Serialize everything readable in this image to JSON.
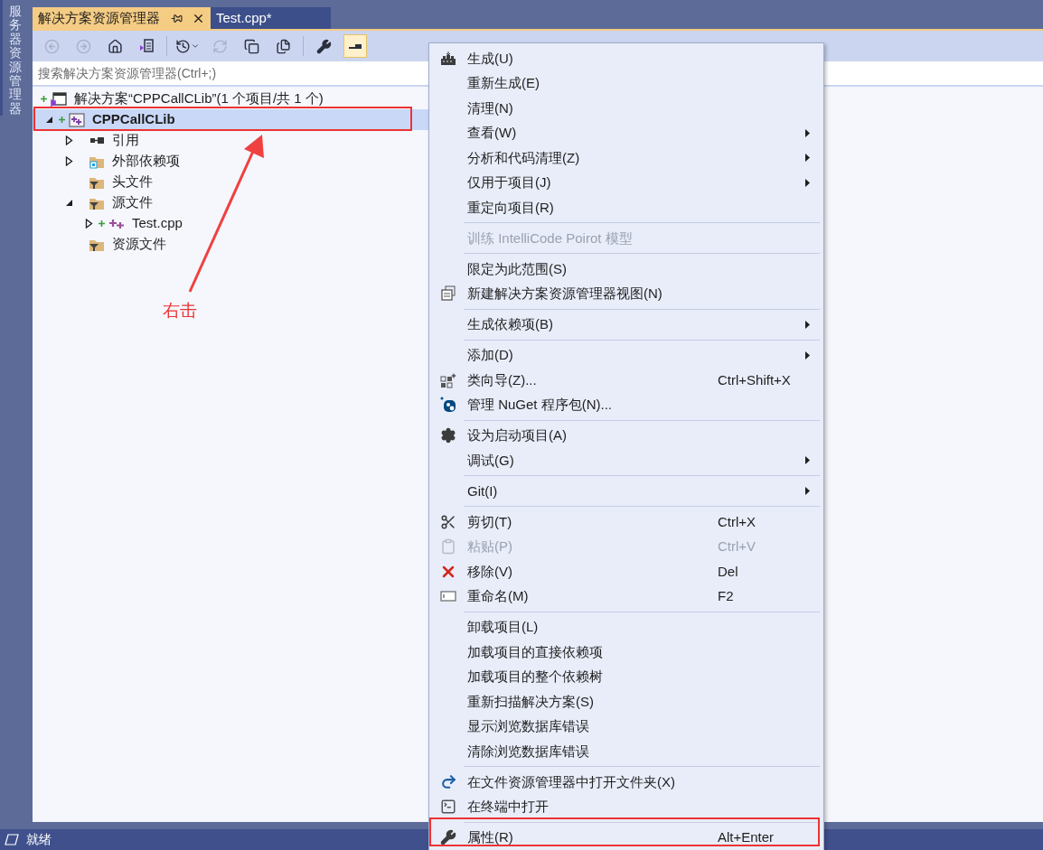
{
  "side_tab": {
    "label": "服务器资源管理器"
  },
  "tabs": [
    {
      "label": "解决方案资源管理器",
      "selected": true
    },
    {
      "label": "Test.cpp*",
      "selected": false
    }
  ],
  "toolbar": [
    {
      "kind": "back",
      "disabled": true,
      "pressed": false
    },
    {
      "kind": "forward",
      "disabled": true,
      "pressed": false
    },
    {
      "kind": "home",
      "disabled": false,
      "pressed": false
    },
    {
      "kind": "switch_views",
      "disabled": false,
      "pressed": false
    },
    {
      "kind": "separator"
    },
    {
      "kind": "pending_changes",
      "disabled": false,
      "pressed": false
    },
    {
      "kind": "refresh",
      "disabled": true,
      "pressed": false
    },
    {
      "kind": "collapse_all",
      "disabled": false,
      "pressed": false
    },
    {
      "kind": "show_all",
      "disabled": false,
      "pressed": false
    },
    {
      "kind": "separator"
    },
    {
      "kind": "properties",
      "disabled": false,
      "pressed": false
    },
    {
      "kind": "preview",
      "disabled": false,
      "pressed": true
    }
  ],
  "search": {
    "placeholder": "搜索解决方案资源管理器(Ctrl+;)"
  },
  "tree": [
    {
      "label": "解决方案“CPPCallCLib”(1 个项目/共 1 个)",
      "kind": "solution",
      "added": true,
      "selected": false,
      "children": [
        {
          "label": "CPPCallCLib",
          "kind": "project",
          "added": true,
          "selected": true,
          "expanded": true,
          "children": [
            {
              "label": "引用",
              "kind": "references",
              "added": false,
              "selected": false,
              "expanded": false
            },
            {
              "label": "外部依赖项",
              "kind": "external",
              "added": false,
              "selected": false,
              "expanded": false
            },
            {
              "label": "头文件",
              "kind": "filter",
              "added": false,
              "selected": false
            },
            {
              "label": "源文件",
              "kind": "filter",
              "added": false,
              "selected": false,
              "expanded": true,
              "children": [
                {
                  "label": "Test.cpp",
                  "kind": "cpp",
                  "added": true,
                  "selected": false,
                  "expanded": false
                }
              ]
            },
            {
              "label": "资源文件",
              "kind": "filter",
              "added": false,
              "selected": false
            }
          ]
        }
      ]
    }
  ],
  "context_menu": [
    {
      "kind": "item",
      "label": "生成(U)",
      "disabled": false,
      "submenu": false
    },
    {
      "kind": "item",
      "label": "重新生成(E)",
      "disabled": false,
      "submenu": false
    },
    {
      "kind": "item",
      "label": "清理(N)",
      "disabled": false,
      "submenu": false
    },
    {
      "kind": "item",
      "label": "查看(W)",
      "disabled": false,
      "submenu": true
    },
    {
      "kind": "item",
      "label": "分析和代码清理(Z)",
      "disabled": false,
      "submenu": true
    },
    {
      "kind": "item",
      "label": "仅用于项目(J)",
      "disabled": false,
      "submenu": true
    },
    {
      "kind": "item",
      "label": "重定向项目(R)",
      "disabled": false,
      "submenu": false
    },
    {
      "kind": "separator"
    },
    {
      "kind": "item",
      "label": "训练 IntelliCode Poirot 模型",
      "disabled": true,
      "submenu": false
    },
    {
      "kind": "separator"
    },
    {
      "kind": "item",
      "label": "限定为此范围(S)",
      "disabled": false,
      "submenu": false
    },
    {
      "kind": "item",
      "label": "新建解决方案资源管理器视图(N)",
      "disabled": false,
      "submenu": false
    },
    {
      "kind": "separator"
    },
    {
      "kind": "item",
      "label": "生成依赖项(B)",
      "disabled": false,
      "submenu": true
    },
    {
      "kind": "separator"
    },
    {
      "kind": "item",
      "label": "添加(D)",
      "disabled": false,
      "submenu": true
    },
    {
      "kind": "item",
      "label": "类向导(Z)...",
      "shortcut": "Ctrl+Shift+X",
      "disabled": false,
      "submenu": false
    },
    {
      "kind": "item",
      "label": "管理 NuGet 程序包(N)...",
      "disabled": false,
      "submenu": false
    },
    {
      "kind": "separator"
    },
    {
      "kind": "item",
      "label": "设为启动项目(A)",
      "disabled": false,
      "submenu": false
    },
    {
      "kind": "item",
      "label": "调试(G)",
      "disabled": false,
      "submenu": true
    },
    {
      "kind": "separator"
    },
    {
      "kind": "item",
      "label": "Git(I)",
      "disabled": false,
      "submenu": true
    },
    {
      "kind": "separator"
    },
    {
      "kind": "item",
      "label": "剪切(T)",
      "shortcut": "Ctrl+X",
      "disabled": false,
      "submenu": false
    },
    {
      "kind": "item",
      "label": "粘贴(P)",
      "shortcut": "Ctrl+V",
      "disabled": true,
      "submenu": false
    },
    {
      "kind": "item",
      "label": "移除(V)",
      "shortcut": "Del",
      "disabled": false,
      "submenu": false
    },
    {
      "kind": "item",
      "label": "重命名(M)",
      "shortcut": "F2",
      "disabled": false,
      "submenu": false
    },
    {
      "kind": "separator"
    },
    {
      "kind": "item",
      "label": "卸载项目(L)",
      "disabled": false,
      "submenu": false
    },
    {
      "kind": "item",
      "label": "加载项目的直接依赖项",
      "disabled": false,
      "submenu": false
    },
    {
      "kind": "item",
      "label": "加载项目的整个依赖树",
      "disabled": false,
      "submenu": false
    },
    {
      "kind": "item",
      "label": "重新扫描解决方案(S)",
      "disabled": false,
      "submenu": false
    },
    {
      "kind": "item",
      "label": "显示浏览数据库错误",
      "disabled": false,
      "submenu": false
    },
    {
      "kind": "item",
      "label": "清除浏览数据库错误",
      "disabled": false,
      "submenu": false
    },
    {
      "kind": "separator"
    },
    {
      "kind": "item",
      "label": "在文件资源管理器中打开文件夹(X)",
      "disabled": false,
      "submenu": false
    },
    {
      "kind": "item",
      "label": "在终端中打开",
      "disabled": false,
      "submenu": false
    },
    {
      "kind": "separator"
    },
    {
      "kind": "item",
      "label": "属性(R)",
      "shortcut": "Alt+Enter",
      "disabled": false,
      "submenu": false
    }
  ],
  "annotation": {
    "label": "右击"
  },
  "status_bar": {
    "text": "就绪"
  }
}
